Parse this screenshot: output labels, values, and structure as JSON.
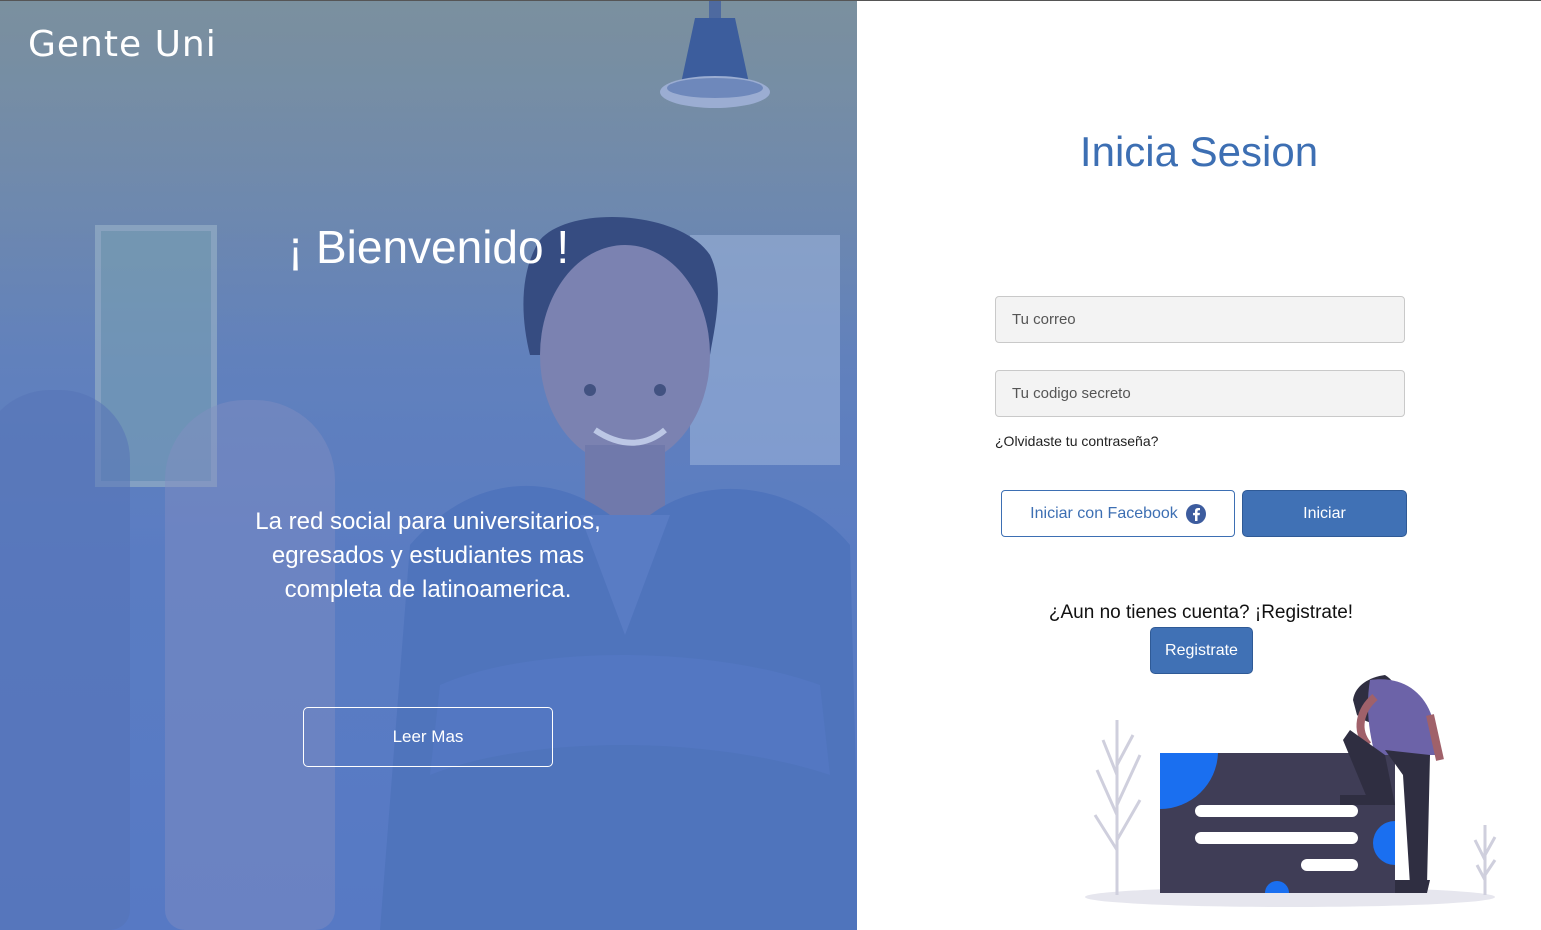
{
  "hero": {
    "brand": "Gente Uni",
    "welcome": "¡ Bienvenido !",
    "tagline": "La red social para universitarios, egresados y estudiantes mas completa de latinoamerica.",
    "read_more": "Leer Mas"
  },
  "login": {
    "title": "Inicia Sesion",
    "email_placeholder": "Tu correo",
    "password_placeholder": "Tu codigo secreto",
    "forgot": "¿Olvidaste tu contraseña?",
    "facebook_label": "Iniciar con Facebook",
    "facebook_icon": "facebook-icon",
    "submit_label": "Iniciar",
    "no_account": "¿Aun no tienes cuenta? ¡Registrate!",
    "register_label": "Registrate"
  },
  "colors": {
    "primary": "#4071b5",
    "hero_overlay": "#5a7bc3",
    "illustration_board": "#3f3d56",
    "illustration_accent": "#1a6ff0"
  }
}
